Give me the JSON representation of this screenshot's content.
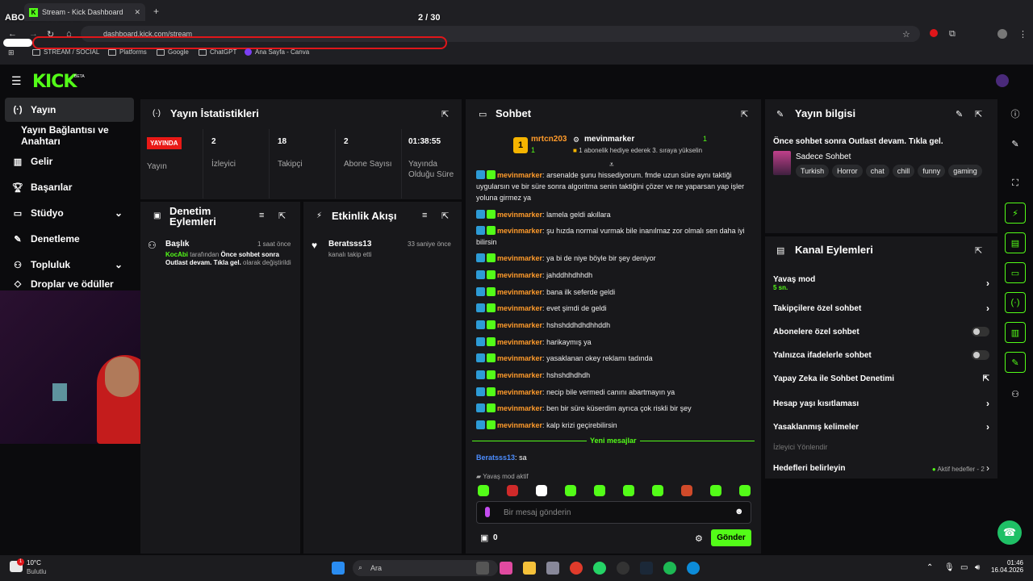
{
  "overlay": {
    "title": "ABONELİK HEDEF",
    "counter": "2 / 30"
  },
  "browser": {
    "tab_title": "Stream - Kick Dashboard",
    "url": "dashboard.kick.com/stream",
    "bookmarks": [
      "STREAM / SOCIAL",
      "Platforms",
      "Google",
      "ChatGPT",
      "Ana Sayfa - Canva"
    ]
  },
  "brand": {
    "logo": "KICK",
    "beta": "BETA",
    "accent": "#53fc18"
  },
  "sidebar": {
    "items": [
      {
        "label": "Yayın",
        "icon": "broadcast-icon"
      },
      {
        "label": "Yayın Bağlantısı ve Anahtarı",
        "icon": "key-icon"
      },
      {
        "label": "Gelir",
        "icon": "revenue-icon"
      },
      {
        "label": "Başarılar",
        "icon": "trophy-icon"
      },
      {
        "label": "Stüdyo",
        "icon": "studio-icon"
      },
      {
        "label": "Denetleme",
        "icon": "wrench-icon"
      },
      {
        "label": "Topluluk",
        "icon": "community-icon"
      },
      {
        "label": "Droplar ve ödüller",
        "icon": "drops-icon"
      }
    ]
  },
  "stats": {
    "title": "Yayın İstatistikleri",
    "live_badge": "YAYINDA",
    "cells": [
      {
        "label": "Yayın",
        "value": ""
      },
      {
        "label": "İzleyici",
        "value": "2"
      },
      {
        "label": "Takipçi",
        "value": "18"
      },
      {
        "label": "Abone Sayısı",
        "value": "2"
      },
      {
        "label": "Yayında Olduğu Süre",
        "value": "01:38:55"
      }
    ]
  },
  "moderation": {
    "title": "Denetim Eylemleri",
    "item": {
      "title": "Başlık",
      "time": "1 saat önce",
      "user": "KocAbi",
      "pre": "tarafından",
      "bold": "Önce sohbet sonra Outlast devam. Tıkla gel.",
      "post": "olarak değiştirildi"
    }
  },
  "activity": {
    "title": "Etkinlik Akışı",
    "item": {
      "user": "Beratsss13",
      "text": "kanalı takip etti",
      "time": "33 saniye önce"
    }
  },
  "chat": {
    "title": "Sohbet",
    "pinned": {
      "user1": "mrtcn203",
      "count1": "1",
      "user2": "mevinmarker",
      "count2": "1",
      "sub_text": "1 abonelik hediye ederek 3. sıraya yükselin"
    },
    "messages": [
      {
        "user": "mevinmarker",
        "text": "arsenalde şunu hissediyorum. fmde uzun süre aynı taktiği uygularsın ve bir süre sonra algoritma senin taktiğini çözer ve ne yaparsan yap işler yoluna girmez ya"
      },
      {
        "user": "mevinmarker",
        "text": "lamela geldi akıllara"
      },
      {
        "user": "mevinmarker",
        "text": "şu hızda normal vurmak bile inanılmaz zor olmalı sen daha iyi bilirsin"
      },
      {
        "user": "mevinmarker",
        "text": "ya bi de niye böyle bir şey deniyor"
      },
      {
        "user": "mevinmarker",
        "text": "jahddhhdhhdh"
      },
      {
        "user": "mevinmarker",
        "text": "bana ilk seferde geldi"
      },
      {
        "user": "mevinmarker",
        "text": "evet şimdi de geldi"
      },
      {
        "user": "mevinmarker",
        "text": "hshshddhdhdhhddh"
      },
      {
        "user": "mevinmarker",
        "text": "harikaymış ya"
      },
      {
        "user": "mevinmarker",
        "text": "yasaklanan okey reklamı tadında"
      },
      {
        "user": "mevinmarker",
        "text": "hshshdhdhdh"
      },
      {
        "user": "mevinmarker",
        "text": "necip bile vermedi canını abartmayın ya"
      },
      {
        "user": "mevinmarker",
        "text": "ben bir süre küserdim ayrıca çok riskli bir şey"
      },
      {
        "user": "mevinmarker",
        "text": "kalp krizi geçirebilirsin"
      }
    ],
    "new_messages": "Yeni mesajlar",
    "new_msg": {
      "user": "Beratsss13",
      "text": "sa"
    },
    "slow_mode": "Yavaş mod aktif",
    "input_placeholder": "Bir mesaj gönderin",
    "points": "0",
    "send_label": "Gönder"
  },
  "stream_info": {
    "title": "Yayın bilgisi",
    "stream_title": "Önce sohbet sonra Outlast devam. Tıkla gel.",
    "category": "Sadece Sohbet",
    "tags": [
      "Turkish",
      "Horror",
      "chat",
      "chill",
      "funny",
      "gaming"
    ]
  },
  "channel_actions": {
    "title": "Kanal Eylemleri",
    "slow_mode": "Yavaş mod",
    "slow_value": "5 sn.",
    "followers_only": "Takipçilere özel sohbet",
    "subs_only": "Abonelere özel sohbet",
    "emotes_only": "Yalnızca ifadelerle sohbet",
    "ai_mod": "Yapay Zeka ile Sohbet Denetimi",
    "age_limit": "Hesap yaşı kısıtlaması",
    "banned_words": "Yasaklanmış kelimeler",
    "viewer_section": "İzleyici Yönlendir",
    "goals": "Hedefleri belirleyin",
    "goals_status": "Aktif hedefler - 2"
  },
  "taskbar": {
    "weather_temp": "10°C",
    "weather_desc": "Bulutlu",
    "search": "Ara",
    "time": "01:46",
    "date": "16.04.2026",
    "badge": "1"
  }
}
